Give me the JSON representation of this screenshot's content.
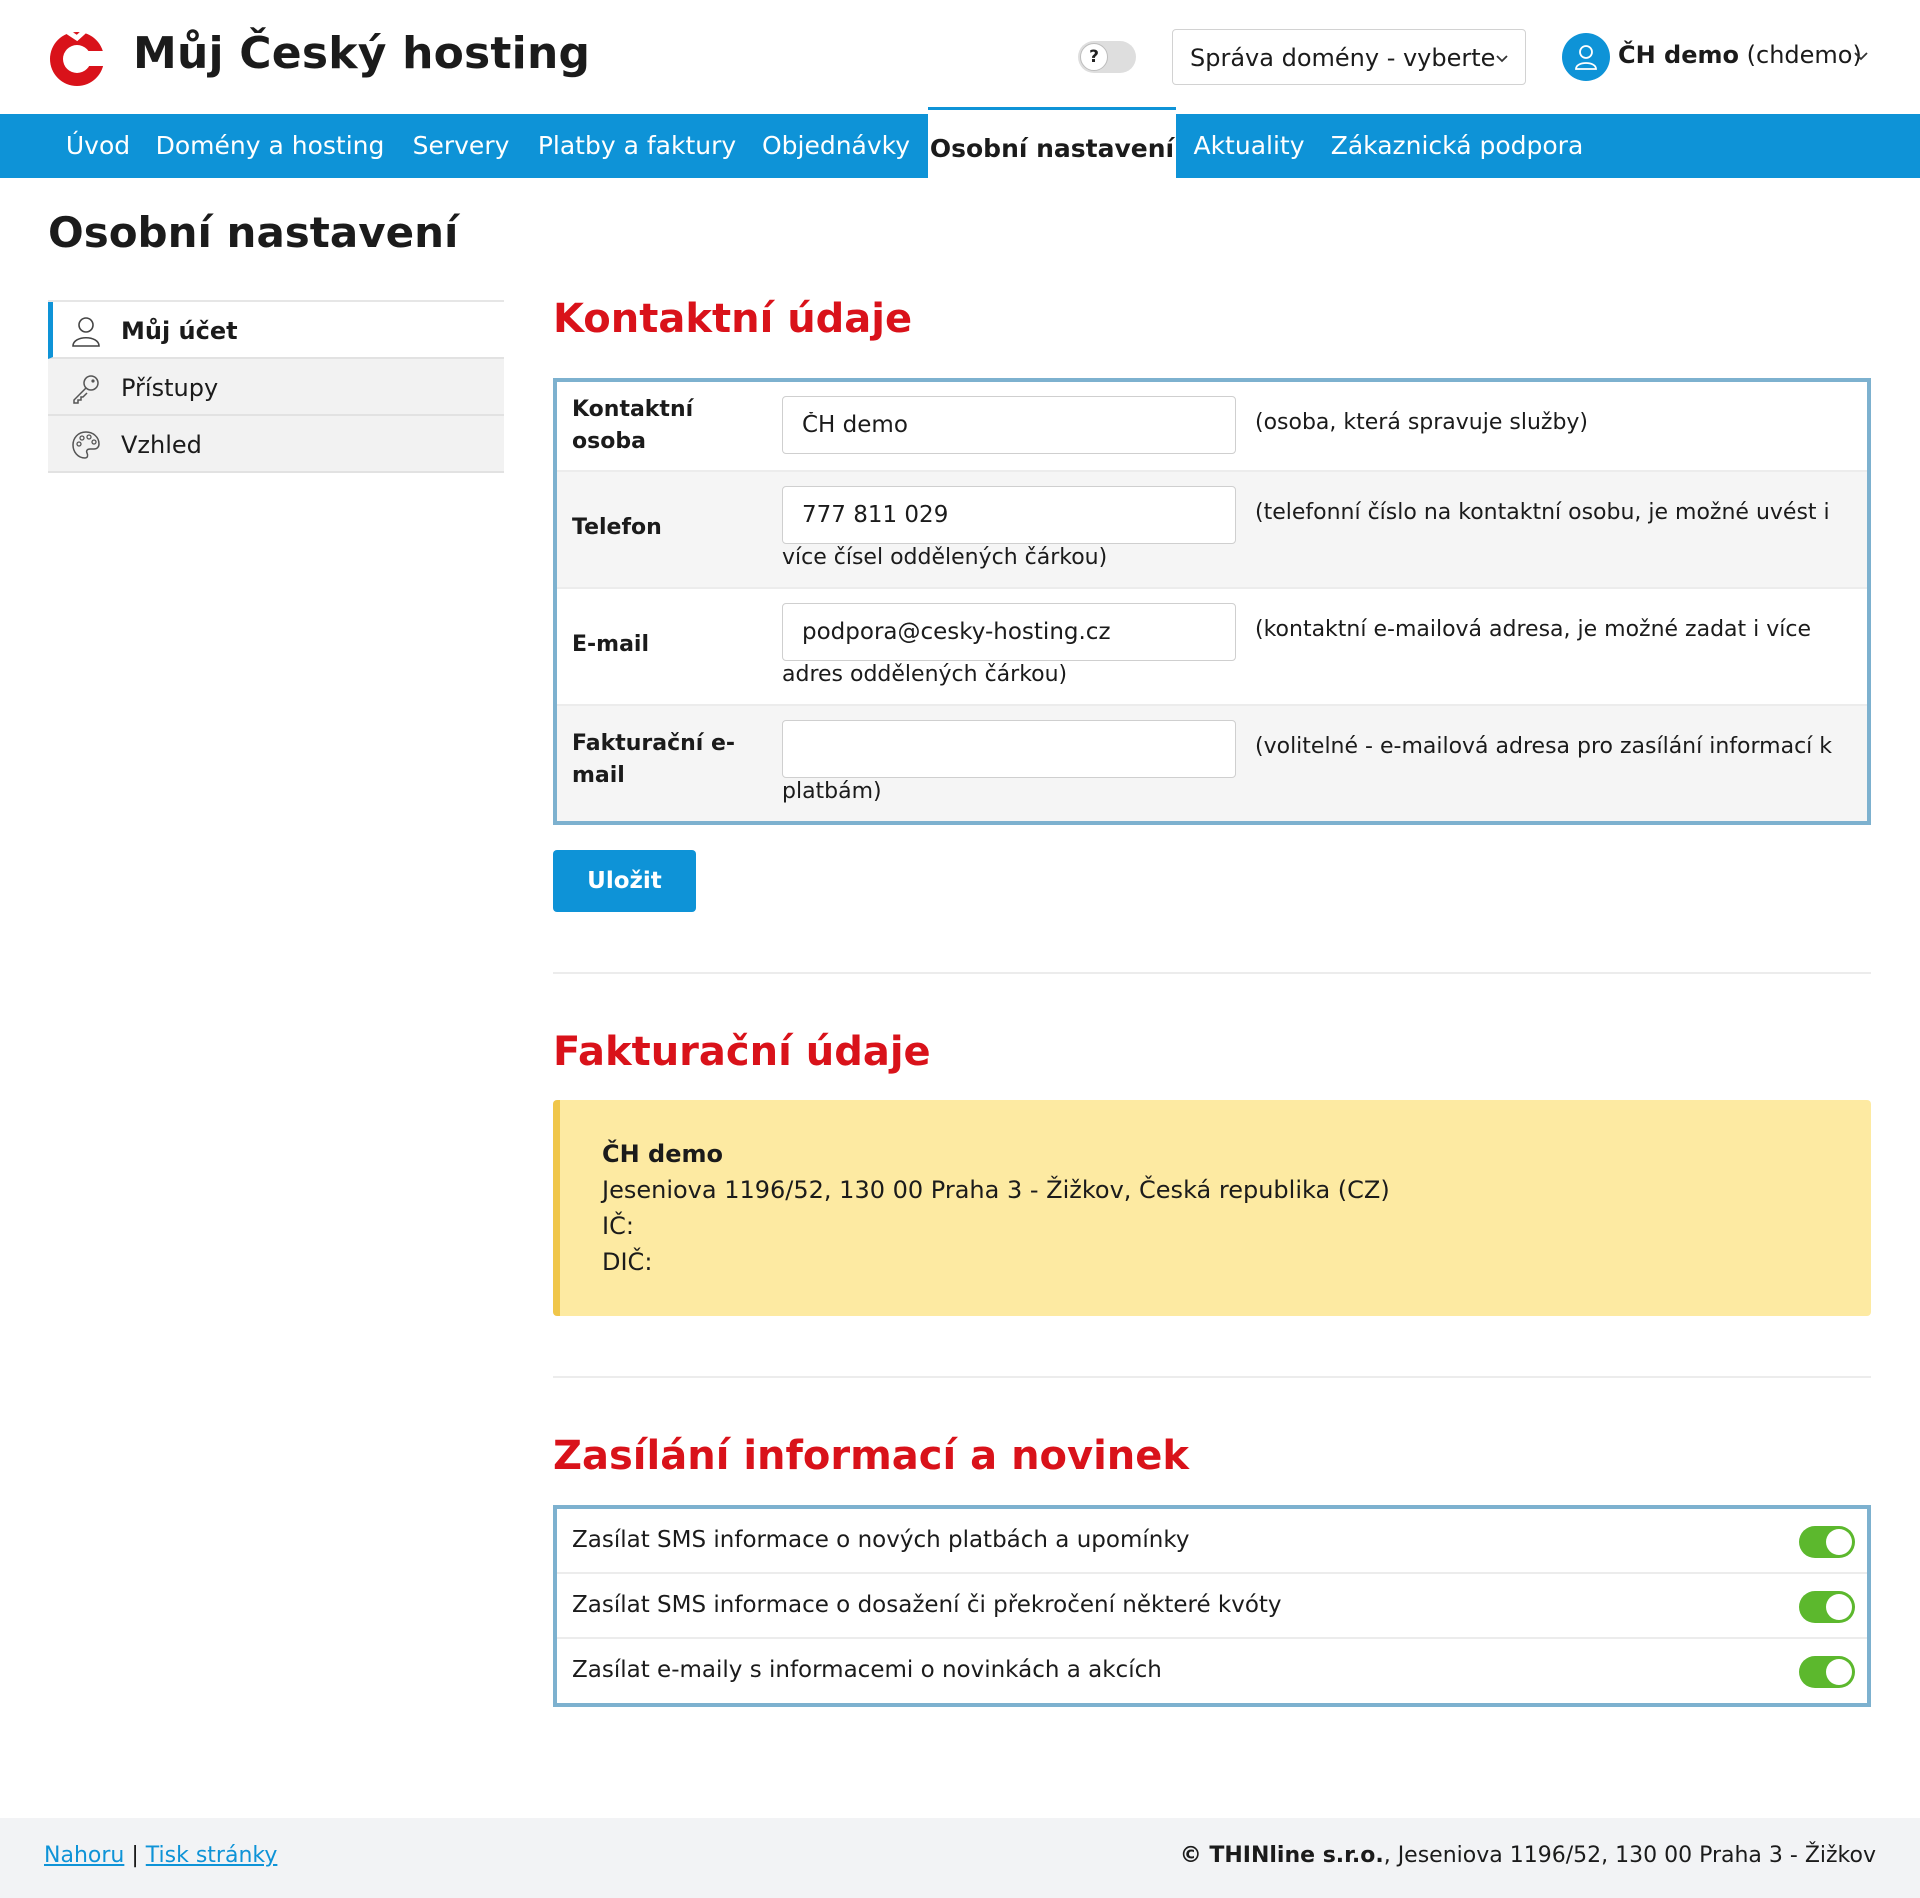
{
  "header": {
    "brand": "Můj Český hosting",
    "help_toggle": "?",
    "domain_select": "Správa domény - vyberte",
    "user_name": "ČH demo",
    "user_login": "(chdemo)"
  },
  "nav": {
    "items": [
      {
        "label": "Úvod"
      },
      {
        "label": "Domény a hosting"
      },
      {
        "label": "Servery"
      },
      {
        "label": "Platby a faktury"
      },
      {
        "label": "Objednávky"
      },
      {
        "label": "Osobní nastavení"
      },
      {
        "label": "Aktuality"
      },
      {
        "label": "Zákaznická podpora"
      }
    ],
    "active": "Osobní nastavení"
  },
  "page": {
    "title": "Osobní nastavení"
  },
  "sidemenu": {
    "items": [
      {
        "label": "Můj účet",
        "icon": "user-icon"
      },
      {
        "label": "Přístupy",
        "icon": "key-icon"
      },
      {
        "label": "Vzhled",
        "icon": "palette-icon"
      }
    ]
  },
  "contact": {
    "title": "Kontaktní údaje",
    "rows": [
      {
        "label_line1": "Kontaktní",
        "label_line2": "osoba",
        "value": "ČH demo",
        "hint_line1": "(osoba, která spravuje služby)",
        "hint_line2": ""
      },
      {
        "label_line1": "Telefon",
        "label_line2": "",
        "value": "777 811 029",
        "hint_line1": "(telefonní číslo na kontaktní osobu, je možné uvést i",
        "hint_line2": "více čísel oddělených čárkou)"
      },
      {
        "label_line1": "E-mail",
        "label_line2": "",
        "value": "podpora@cesky-hosting.cz",
        "hint_line1": "(kontaktní e-mailová adresa, je možné zadat i více",
        "hint_line2": "adres oddělených čárkou)"
      },
      {
        "label_line1": "Fakturační e-",
        "label_line2": "mail",
        "value": "",
        "hint_line1": "(volitelné - e-mailová adresa pro zasílání informací k",
        "hint_line2": "platbám)"
      }
    ],
    "save_label": "Uložit"
  },
  "billing": {
    "title": "Fakturační údaje",
    "name": "ČH demo",
    "address": "Jeseniova 1196/52, 130 00 Praha 3 - Žižkov, Česká republika (CZ)",
    "ic": "IČ:",
    "dic": "DIČ:"
  },
  "news": {
    "title": "Zasílání informací a novinek",
    "items": [
      {
        "label": "Zasílat SMS informace o nových platbách a upomínky",
        "enabled": true
      },
      {
        "label": "Zasílat SMS informace o dosažení či překročení některé kvóty",
        "enabled": true
      },
      {
        "label": "Zasílat e-maily s informacemi o novinkách a akcích",
        "enabled": true
      }
    ]
  },
  "footer": {
    "link_top": "Nahoru",
    "separator": "|",
    "link_print": "Tisk stránky",
    "company": "© THINline s.r.o.",
    "address": ", Jeseniova 1196/52, 130 00 Praha 3 - Žižkov"
  },
  "colors": {
    "accent": "#0e93d7",
    "heading_red": "#d9121a",
    "toggle_green": "#5cb82d",
    "billing_bg": "#fdeaa2",
    "billing_border": "#f0c64a",
    "box_border": "#7db1cf"
  }
}
